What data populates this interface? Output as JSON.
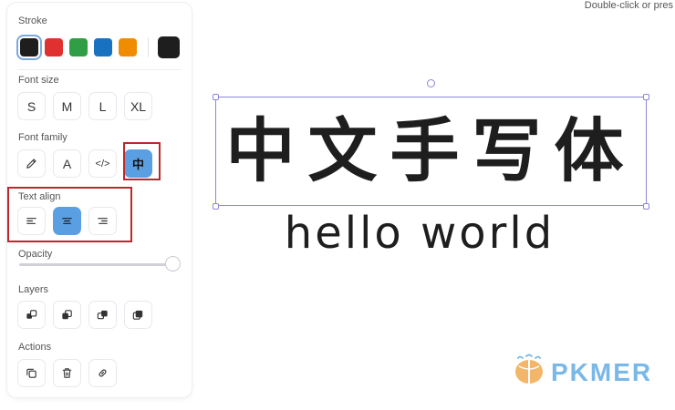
{
  "panel": {
    "stroke": {
      "label": "Stroke",
      "swatches": [
        {
          "name": "black",
          "color": "#1e1e1e",
          "selected": true
        },
        {
          "name": "red",
          "color": "#e03131"
        },
        {
          "name": "green",
          "color": "#2f9e44"
        },
        {
          "name": "blue",
          "color": "#1971c2"
        },
        {
          "name": "orange",
          "color": "#f08c00"
        }
      ],
      "custom_color": "#1e1e1e"
    },
    "font_size": {
      "label": "Font size",
      "options": [
        "S",
        "M",
        "L",
        "XL"
      ]
    },
    "font_family": {
      "label": "Font family",
      "options": [
        {
          "name": "hand-drawn",
          "icon": "pencil-icon"
        },
        {
          "name": "normal",
          "glyph": "A"
        },
        {
          "name": "code",
          "glyph": "</>"
        },
        {
          "name": "chinese-handwriting",
          "glyph": "中",
          "selected": true
        }
      ]
    },
    "text_align": {
      "label": "Text align",
      "options": [
        {
          "name": "left",
          "icon": "align-left-icon"
        },
        {
          "name": "center",
          "icon": "align-center-icon",
          "selected": true
        },
        {
          "name": "right",
          "icon": "align-right-icon"
        }
      ]
    },
    "opacity": {
      "label": "Opacity",
      "value": 100
    },
    "layers": {
      "label": "Layers",
      "options": [
        "send-to-back-icon",
        "send-backward-icon",
        "bring-forward-icon",
        "bring-to-front-icon"
      ]
    },
    "actions": {
      "label": "Actions",
      "options": [
        "duplicate-icon",
        "delete-icon",
        "link-icon"
      ]
    }
  },
  "canvas": {
    "hint": "Double-click or pres",
    "text_line_1": "中文手写体",
    "text_line_2": "hello world",
    "highlight_color": "#c0272d",
    "selection_color": "#8b87da"
  },
  "watermark": {
    "text": "PKMER",
    "color": "#7ab8e8"
  }
}
